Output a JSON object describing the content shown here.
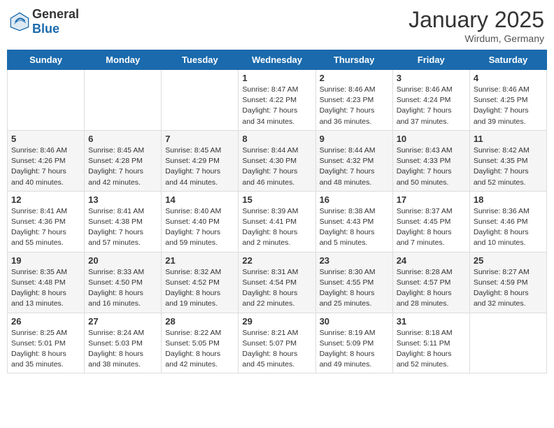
{
  "header": {
    "logo_general": "General",
    "logo_blue": "Blue",
    "month_title": "January 2025",
    "location": "Wirdum, Germany"
  },
  "weekdays": [
    "Sunday",
    "Monday",
    "Tuesday",
    "Wednesday",
    "Thursday",
    "Friday",
    "Saturday"
  ],
  "weeks": [
    [
      {
        "day": "",
        "info": ""
      },
      {
        "day": "",
        "info": ""
      },
      {
        "day": "",
        "info": ""
      },
      {
        "day": "1",
        "info": "Sunrise: 8:47 AM\nSunset: 4:22 PM\nDaylight: 7 hours\nand 34 minutes."
      },
      {
        "day": "2",
        "info": "Sunrise: 8:46 AM\nSunset: 4:23 PM\nDaylight: 7 hours\nand 36 minutes."
      },
      {
        "day": "3",
        "info": "Sunrise: 8:46 AM\nSunset: 4:24 PM\nDaylight: 7 hours\nand 37 minutes."
      },
      {
        "day": "4",
        "info": "Sunrise: 8:46 AM\nSunset: 4:25 PM\nDaylight: 7 hours\nand 39 minutes."
      }
    ],
    [
      {
        "day": "5",
        "info": "Sunrise: 8:46 AM\nSunset: 4:26 PM\nDaylight: 7 hours\nand 40 minutes."
      },
      {
        "day": "6",
        "info": "Sunrise: 8:45 AM\nSunset: 4:28 PM\nDaylight: 7 hours\nand 42 minutes."
      },
      {
        "day": "7",
        "info": "Sunrise: 8:45 AM\nSunset: 4:29 PM\nDaylight: 7 hours\nand 44 minutes."
      },
      {
        "day": "8",
        "info": "Sunrise: 8:44 AM\nSunset: 4:30 PM\nDaylight: 7 hours\nand 46 minutes."
      },
      {
        "day": "9",
        "info": "Sunrise: 8:44 AM\nSunset: 4:32 PM\nDaylight: 7 hours\nand 48 minutes."
      },
      {
        "day": "10",
        "info": "Sunrise: 8:43 AM\nSunset: 4:33 PM\nDaylight: 7 hours\nand 50 minutes."
      },
      {
        "day": "11",
        "info": "Sunrise: 8:42 AM\nSunset: 4:35 PM\nDaylight: 7 hours\nand 52 minutes."
      }
    ],
    [
      {
        "day": "12",
        "info": "Sunrise: 8:41 AM\nSunset: 4:36 PM\nDaylight: 7 hours\nand 55 minutes."
      },
      {
        "day": "13",
        "info": "Sunrise: 8:41 AM\nSunset: 4:38 PM\nDaylight: 7 hours\nand 57 minutes."
      },
      {
        "day": "14",
        "info": "Sunrise: 8:40 AM\nSunset: 4:40 PM\nDaylight: 7 hours\nand 59 minutes."
      },
      {
        "day": "15",
        "info": "Sunrise: 8:39 AM\nSunset: 4:41 PM\nDaylight: 8 hours\nand 2 minutes."
      },
      {
        "day": "16",
        "info": "Sunrise: 8:38 AM\nSunset: 4:43 PM\nDaylight: 8 hours\nand 5 minutes."
      },
      {
        "day": "17",
        "info": "Sunrise: 8:37 AM\nSunset: 4:45 PM\nDaylight: 8 hours\nand 7 minutes."
      },
      {
        "day": "18",
        "info": "Sunrise: 8:36 AM\nSunset: 4:46 PM\nDaylight: 8 hours\nand 10 minutes."
      }
    ],
    [
      {
        "day": "19",
        "info": "Sunrise: 8:35 AM\nSunset: 4:48 PM\nDaylight: 8 hours\nand 13 minutes."
      },
      {
        "day": "20",
        "info": "Sunrise: 8:33 AM\nSunset: 4:50 PM\nDaylight: 8 hours\nand 16 minutes."
      },
      {
        "day": "21",
        "info": "Sunrise: 8:32 AM\nSunset: 4:52 PM\nDaylight: 8 hours\nand 19 minutes."
      },
      {
        "day": "22",
        "info": "Sunrise: 8:31 AM\nSunset: 4:54 PM\nDaylight: 8 hours\nand 22 minutes."
      },
      {
        "day": "23",
        "info": "Sunrise: 8:30 AM\nSunset: 4:55 PM\nDaylight: 8 hours\nand 25 minutes."
      },
      {
        "day": "24",
        "info": "Sunrise: 8:28 AM\nSunset: 4:57 PM\nDaylight: 8 hours\nand 28 minutes."
      },
      {
        "day": "25",
        "info": "Sunrise: 8:27 AM\nSunset: 4:59 PM\nDaylight: 8 hours\nand 32 minutes."
      }
    ],
    [
      {
        "day": "26",
        "info": "Sunrise: 8:25 AM\nSunset: 5:01 PM\nDaylight: 8 hours\nand 35 minutes."
      },
      {
        "day": "27",
        "info": "Sunrise: 8:24 AM\nSunset: 5:03 PM\nDaylight: 8 hours\nand 38 minutes."
      },
      {
        "day": "28",
        "info": "Sunrise: 8:22 AM\nSunset: 5:05 PM\nDaylight: 8 hours\nand 42 minutes."
      },
      {
        "day": "29",
        "info": "Sunrise: 8:21 AM\nSunset: 5:07 PM\nDaylight: 8 hours\nand 45 minutes."
      },
      {
        "day": "30",
        "info": "Sunrise: 8:19 AM\nSunset: 5:09 PM\nDaylight: 8 hours\nand 49 minutes."
      },
      {
        "day": "31",
        "info": "Sunrise: 8:18 AM\nSunset: 5:11 PM\nDaylight: 8 hours\nand 52 minutes."
      },
      {
        "day": "",
        "info": ""
      }
    ]
  ]
}
